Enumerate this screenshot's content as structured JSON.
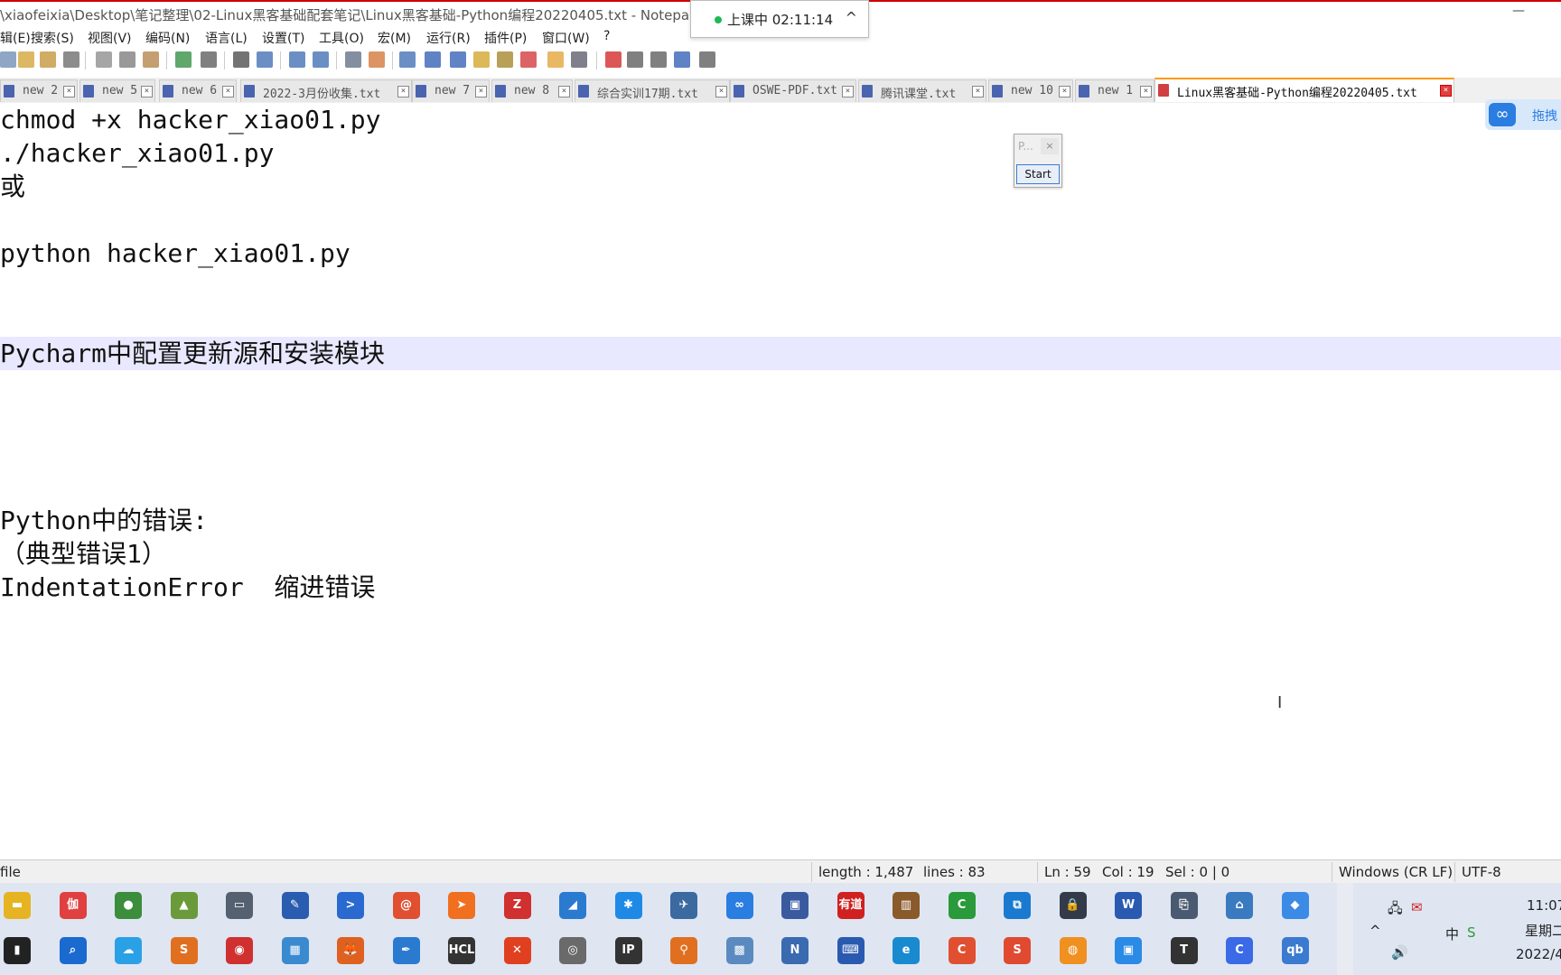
{
  "window": {
    "title": "\\xiaofeixia\\Desktop\\笔记整理\\02-Linux黑客基础配套笔记\\Linux黑客基础-Python编程20220405.txt - Notepad",
    "minimize_glyph": "—"
  },
  "class_status": {
    "label": "上课中 02:11:14",
    "chevron": "^"
  },
  "menu": [
    "辑(E)",
    "搜索(S)",
    "视图(V)",
    "编码(N)",
    "语言(L)",
    "设置(T)",
    "工具(O)",
    "宏(M)",
    "运行(R)",
    "插件(P)",
    "窗口(W)",
    "?"
  ],
  "tabs": [
    {
      "label": "new 2",
      "active": false
    },
    {
      "label": "new 5",
      "active": false
    },
    {
      "label": "new 6",
      "active": false
    },
    {
      "label": "2022-3月份收集.txt",
      "active": false
    },
    {
      "label": "new 7",
      "active": false
    },
    {
      "label": "new 8",
      "active": false
    },
    {
      "label": "综合实训17期.txt",
      "active": false
    },
    {
      "label": "OSWE-PDF.txt",
      "active": false
    },
    {
      "label": "腾讯课堂.txt",
      "active": false
    },
    {
      "label": "new 10",
      "active": false
    },
    {
      "label": "new 1",
      "active": false
    },
    {
      "label": "Linux黑客基础-Python编程20220405.txt",
      "active": true
    }
  ],
  "editor": {
    "lines": [
      {
        "text": "chmod +x hacker_xiao01.py",
        "highlight": false
      },
      {
        "text": "./hacker_xiao01.py",
        "highlight": false
      },
      {
        "text": "或",
        "highlight": false
      },
      {
        "text": "",
        "highlight": false
      },
      {
        "text": "python hacker_xiao01.py",
        "highlight": false
      },
      {
        "text": "",
        "highlight": false
      },
      {
        "text": "",
        "highlight": false
      },
      {
        "text": "Pycharm中配置更新源和安装模块",
        "highlight": true
      },
      {
        "text": "",
        "highlight": false
      },
      {
        "text": "",
        "highlight": false
      },
      {
        "text": "",
        "highlight": false
      },
      {
        "text": "",
        "highlight": false
      },
      {
        "text": "Python中的错误:",
        "highlight": false
      },
      {
        "text": "（典型错误1）",
        "highlight": false
      },
      {
        "text": "IndentationError  缩进错误",
        "highlight": false
      }
    ]
  },
  "mini_dialog": {
    "title": "P...",
    "close": "×",
    "start_label": "Start"
  },
  "cloud_badge": {
    "text": "拖拽"
  },
  "status": {
    "file_type": "file",
    "length": "length : 1,487",
    "lines": "lines : 83",
    "ln": "Ln : 59",
    "col": "Col : 19",
    "sel": "Sel : 0 | 0",
    "eol": "Windows (CR LF)",
    "encoding": "UTF-8"
  },
  "tray": {
    "time": "11:07",
    "weekday": "星期二",
    "date": "2022/4",
    "ime": "中",
    "volume": "🔊"
  },
  "taskbar_row1": [
    {
      "name": "folder",
      "color": "#e6b422",
      "glyph": "▬"
    },
    {
      "name": "burp",
      "color": "#e04040",
      "glyph": "伽"
    },
    {
      "name": "chrome",
      "color": "#3c8d3c",
      "glyph": "●"
    },
    {
      "name": "image-tool",
      "color": "#6a9a3a",
      "glyph": "▲"
    },
    {
      "name": "window-tool",
      "color": "#556070",
      "glyph": "▭"
    },
    {
      "name": "editor",
      "color": "#2a5db0",
      "glyph": "✎"
    },
    {
      "name": "powershell",
      "color": "#2a6ad0",
      "glyph": ">"
    },
    {
      "name": "swirl",
      "color": "#e05030",
      "glyph": "@"
    },
    {
      "name": "arrow-app",
      "color": "#f07020",
      "glyph": "➤"
    },
    {
      "name": "filezilla",
      "color": "#d03030",
      "glyph": "Z"
    },
    {
      "name": "shark",
      "color": "#2a7ad0",
      "glyph": "◢"
    },
    {
      "name": "star-app",
      "color": "#1e8ae6",
      "glyph": "✱"
    },
    {
      "name": "bird",
      "color": "#3a6aa0",
      "glyph": "✈"
    },
    {
      "name": "baidu-pan",
      "color": "#2a7de1",
      "glyph": "∞"
    },
    {
      "name": "floppy",
      "color": "#3a5aa0",
      "glyph": "▣"
    },
    {
      "name": "youdao",
      "color": "#d02020",
      "glyph": "有道"
    },
    {
      "name": "books",
      "color": "#8a5a2a",
      "glyph": "▥"
    },
    {
      "name": "camtasia",
      "color": "#2a9a3a",
      "glyph": "C"
    },
    {
      "name": "remote",
      "color": "#1a7ad0",
      "glyph": "⧉"
    },
    {
      "name": "lock-app",
      "color": "#333a4a",
      "glyph": "🔒"
    },
    {
      "name": "word",
      "color": "#2a5ab0",
      "glyph": "W"
    },
    {
      "name": "usb-tool",
      "color": "#4a5a70",
      "glyph": "⎘"
    },
    {
      "name": "network-tool",
      "color": "#3a7ac0",
      "glyph": "⌂"
    },
    {
      "name": "feishu",
      "color": "#3a8ae6",
      "glyph": "◆"
    }
  ],
  "taskbar_row2": [
    {
      "name": "terminal",
      "color": "#222",
      "glyph": "▮"
    },
    {
      "name": "search-app",
      "color": "#1a6ad0",
      "glyph": "⌕"
    },
    {
      "name": "cloud-app",
      "color": "#2aa0e6",
      "glyph": "☁"
    },
    {
      "name": "sublime",
      "color": "#e07020",
      "glyph": "S"
    },
    {
      "name": "pokeball",
      "color": "#d03030",
      "glyph": "◉"
    },
    {
      "name": "live-app",
      "color": "#3a8ad0",
      "glyph": "▦"
    },
    {
      "name": "firefox",
      "color": "#e06020",
      "glyph": "🦊"
    },
    {
      "name": "feather",
      "color": "#2a7ad0",
      "glyph": "✒"
    },
    {
      "name": "hcl",
      "color": "#333",
      "glyph": "HCL"
    },
    {
      "name": "xmind",
      "color": "#e04020",
      "glyph": "✕"
    },
    {
      "name": "disc",
      "color": "#6a6a6a",
      "glyph": "◎"
    },
    {
      "name": "tcpip",
      "color": "#333",
      "glyph": "IP"
    },
    {
      "name": "magnifier",
      "color": "#e07020",
      "glyph": "⚲"
    },
    {
      "name": "map-app",
      "color": "#5a8ac0",
      "glyph": "▩"
    },
    {
      "name": "notes",
      "color": "#3a6ab0",
      "glyph": "N"
    },
    {
      "name": "ps-terminal",
      "color": "#2a5ab0",
      "glyph": "⌨"
    },
    {
      "name": "edge",
      "color": "#1a8ad0",
      "glyph": "e"
    },
    {
      "name": "c-app",
      "color": "#e05030",
      "glyph": "C"
    },
    {
      "name": "s-app",
      "color": "#e04a30",
      "glyph": "S"
    },
    {
      "name": "orange-app",
      "color": "#f09020",
      "glyph": "◍"
    },
    {
      "name": "bilibili",
      "color": "#2a8ae6",
      "glyph": "▣"
    },
    {
      "name": "typora",
      "color": "#333",
      "glyph": "T"
    },
    {
      "name": "circle-app",
      "color": "#3a6ae6",
      "glyph": "C"
    },
    {
      "name": "qbittorrent",
      "color": "#3a7ad0",
      "glyph": "qb"
    }
  ]
}
